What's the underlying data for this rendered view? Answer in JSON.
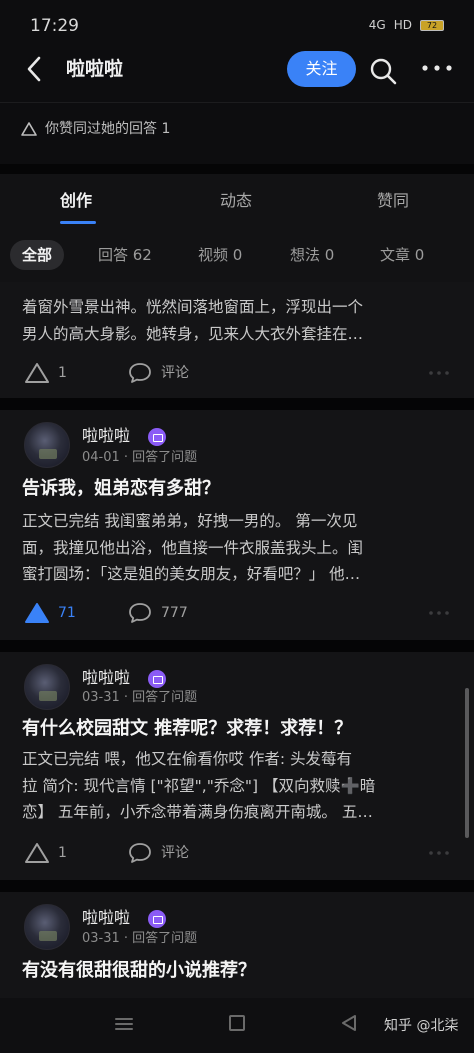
{
  "status_bar": {
    "time": "17:29",
    "signal": "4G",
    "wifi": "HD",
    "battery": "72"
  },
  "nav": {
    "title": "啦啦啦",
    "follow_label": "关注"
  },
  "liked_note": "你赞同过她的回答 1",
  "tabs": [
    {
      "label": "创作",
      "active": true
    },
    {
      "label": "动态",
      "active": false
    },
    {
      "label": "赞同",
      "active": false
    }
  ],
  "filters": [
    {
      "label": "全部",
      "active": true
    },
    {
      "label": "回答 62",
      "active": false
    },
    {
      "label": "视频 0",
      "active": false
    },
    {
      "label": "想法 0",
      "active": false
    },
    {
      "label": "文章 0",
      "active": false
    }
  ],
  "cards": [
    {
      "excerpt_lines": [
        "着窗外雪景出神。恍然间落地窗面上，浮现出一个",
        "男人的高大身影。她转身，见来人大衣外套挂在…"
      ],
      "vote_count": "1",
      "vote_active": false,
      "comment_label": "评论"
    },
    {
      "author": "啦啦啦",
      "meta": "04-01 · 回答了问题",
      "title": "告诉我，姐弟恋有多甜？",
      "excerpt_lines": [
        "正文已完结 我闺蜜弟弟，好拽一男的。 第一次见",
        "面，我撞见他出浴，他直接一件衣服盖我头上。闺",
        "蜜打圆场：「这是姐的美女朋友，好看吧？」 他…"
      ],
      "vote_count": "71",
      "vote_active": true,
      "comment_label": "777"
    },
    {
      "author": "啦啦啦",
      "meta": "03-31 · 回答了问题",
      "title": "有什么校园甜文 推荐呢？求荐！求荐！？",
      "excerpt_lines": [
        "正文已完结 喂，他又在偷看你哎 作者: 头发莓有",
        "拉 简介: 现代言情 [\"祁望\",\"乔念\"] 【双向救赎➕暗",
        "恋】 五年前，小乔念带着满身伤痕离开南城。 五…"
      ],
      "vote_count": "1",
      "vote_active": false,
      "comment_label": "评论"
    },
    {
      "author": "啦啦啦",
      "meta": "03-31 · 回答了问题",
      "title": "有没有很甜很甜的小说推荐？"
    }
  ],
  "watermark": "知乎 @北柒",
  "colors": {
    "accent": "#3a82f7",
    "background": "#0d0d0f",
    "card": "#141416"
  }
}
